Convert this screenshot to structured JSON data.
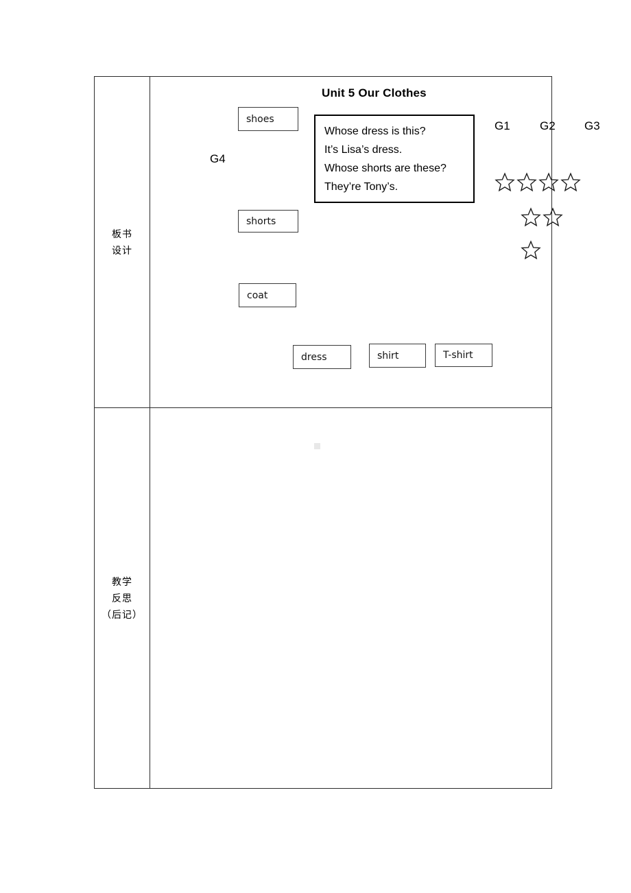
{
  "document": {
    "type": "lesson-plan-table"
  },
  "table": {
    "rows": [
      {
        "label": "板书\n设计",
        "label_lines": [
          "板书",
          "设计"
        ]
      },
      {
        "label": "教学\n反思\n（后记）",
        "label_lines": [
          "教学",
          "反思",
          "（后记）"
        ]
      }
    ]
  },
  "labels": {
    "board_design_line1": "板书",
    "board_design_line2": "设计",
    "reflection_line1": "教学",
    "reflection_line2": "反思",
    "reflection_line3": "（后记）"
  },
  "board": {
    "title": "Unit 5 Our Clothes",
    "word_cards": [
      {
        "id": "shoes",
        "text": "shoes"
      },
      {
        "id": "shorts",
        "text": "shorts"
      },
      {
        "id": "coat",
        "text": "coat"
      },
      {
        "id": "dress",
        "text": "dress"
      },
      {
        "id": "shirt",
        "text": "shirt"
      },
      {
        "id": "tshirt",
        "text": "T-shirt"
      }
    ],
    "dialogue": {
      "lines": [
        "Whose dress is this?",
        "It’s Lisa’s dress.",
        "Whose shorts are these?",
        "They’re Tony’s."
      ]
    },
    "groups": [
      {
        "id": "g1",
        "label": "G1"
      },
      {
        "id": "g2",
        "label": "G2"
      },
      {
        "id": "g3",
        "label": "G3"
      },
      {
        "id": "g4",
        "label": "G4"
      }
    ],
    "star_rows": [
      {
        "count": 4
      },
      {
        "count": 2
      },
      {
        "count": 1
      }
    ],
    "star_icon": "star-outline-icon"
  },
  "colors": {
    "border": "#2b2b2b",
    "card_border": "#3a3a3a",
    "dialogue_border": "#000000",
    "text": "#000000",
    "page_background": "#ffffff",
    "faint_mark": "#e8e8e8"
  }
}
